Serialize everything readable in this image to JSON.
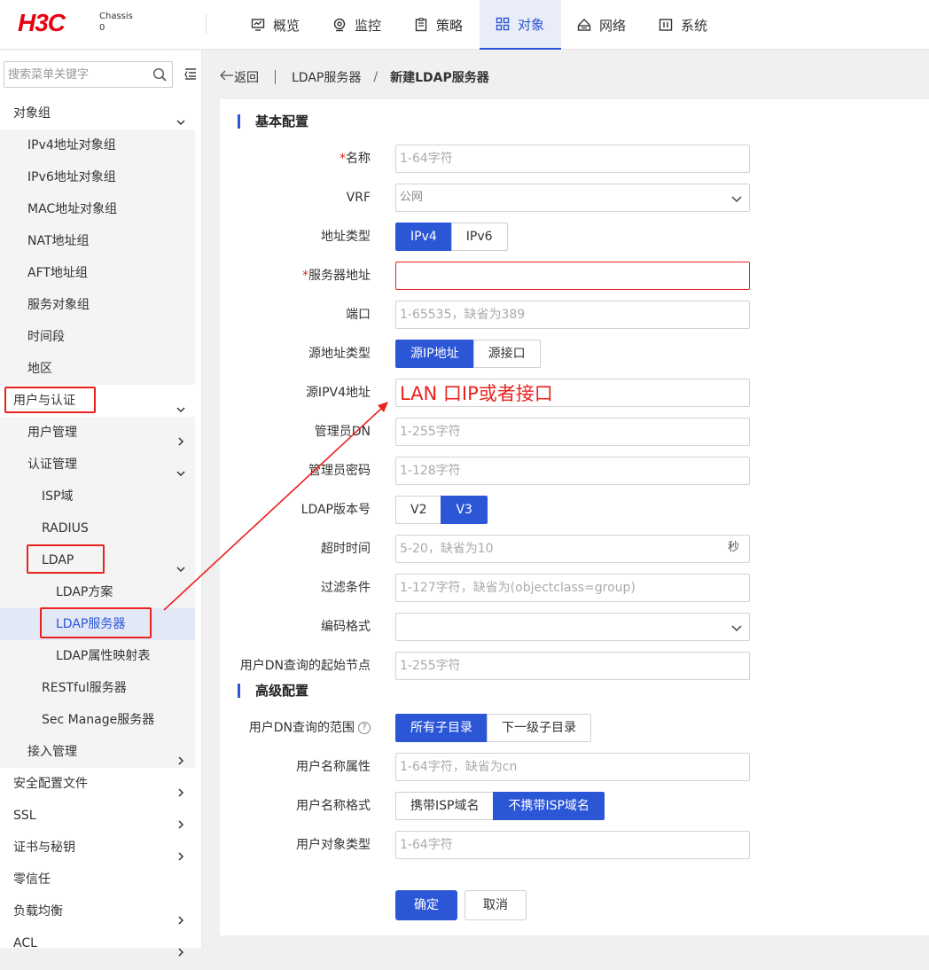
{
  "header": {
    "logo": "H3C",
    "chassis_label": "Chassis",
    "chassis_value": "0",
    "nav": [
      {
        "label": "概览",
        "icon": "monitor-chart-icon"
      },
      {
        "label": "监控",
        "icon": "eye-icon"
      },
      {
        "label": "策略",
        "icon": "document-icon"
      },
      {
        "label": "对象",
        "icon": "grid-icon"
      },
      {
        "label": "网络",
        "icon": "network-icon"
      },
      {
        "label": "系统",
        "icon": "settings-panel-icon"
      }
    ],
    "active_nav": "对象"
  },
  "sidebar": {
    "search_placeholder": "搜索菜单关键字",
    "items": [
      {
        "label": "对象组",
        "chevron": "down"
      },
      {
        "label": "IPv4地址对象组"
      },
      {
        "label": "IPv6地址对象组"
      },
      {
        "label": "MAC地址对象组"
      },
      {
        "label": "NAT地址组"
      },
      {
        "label": "AFT地址组"
      },
      {
        "label": "服务对象组"
      },
      {
        "label": "时间段"
      },
      {
        "label": "地区"
      },
      {
        "label": "用户与认证",
        "chevron": "down"
      },
      {
        "label": "用户管理",
        "chevron": "right"
      },
      {
        "label": "认证管理",
        "chevron": "down"
      },
      {
        "label": "ISP域"
      },
      {
        "label": "RADIUS"
      },
      {
        "label": "LDAP",
        "chevron": "down"
      },
      {
        "label": "LDAP方案"
      },
      {
        "label": "LDAP服务器"
      },
      {
        "label": "LDAP属性映射表"
      },
      {
        "label": "RESTful服务器"
      },
      {
        "label": "Sec Manage服务器"
      },
      {
        "label": "接入管理",
        "chevron": "right"
      },
      {
        "label": "安全配置文件",
        "chevron": "right"
      },
      {
        "label": "SSL",
        "chevron": "right"
      },
      {
        "label": "证书与秘钥",
        "chevron": "right"
      },
      {
        "label": "零信任"
      },
      {
        "label": "负载均衡",
        "chevron": "right"
      },
      {
        "label": "ACL",
        "chevron": "right"
      }
    ]
  },
  "breadcrumb": {
    "back": "返回",
    "parent": "LDAP服务器",
    "separator": "/",
    "current": "新建LDAP服务器"
  },
  "form": {
    "basic_title": "基本配置",
    "advanced_title": "高级配置",
    "name": {
      "label": "名称",
      "required": "*",
      "placeholder": "1-64字符"
    },
    "vrf": {
      "label": "VRF",
      "value": "公网"
    },
    "addr_type": {
      "label": "地址类型",
      "options": [
        "IPv4",
        "IPv6"
      ],
      "selected": "IPv4"
    },
    "server_addr": {
      "label": "服务器地址",
      "required": "*",
      "placeholder": ""
    },
    "port": {
      "label": "端口",
      "placeholder": "1-65535，缺省为389"
    },
    "src_addr_type": {
      "label": "源地址类型",
      "options": [
        "源IP地址",
        "源接口"
      ],
      "selected": "源IP地址"
    },
    "src_ipv4": {
      "label": "源IPV4地址",
      "value": ""
    },
    "admin_dn": {
      "label": "管理员DN",
      "placeholder": "1-255字符"
    },
    "admin_pwd": {
      "label": "管理员密码",
      "placeholder": "1-128字符"
    },
    "ldap_version": {
      "label": "LDAP版本号",
      "options": [
        "V2",
        "V3"
      ],
      "selected": "V3"
    },
    "timeout": {
      "label": "超时时间",
      "placeholder": "5-20，缺省为10",
      "unit": "秒"
    },
    "filter": {
      "label": "过滤条件",
      "placeholder": "1-127字符，缺省为(objectclass=group)"
    },
    "encoding": {
      "label": "编码格式",
      "value": ""
    },
    "start_node": {
      "label": "用户DN查询的起始节点",
      "placeholder": "1-255字符"
    },
    "dn_scope": {
      "label": "用户DN查询的范围",
      "options": [
        "所有子目录",
        "下一级子目录"
      ],
      "selected": "所有子目录",
      "help": "?"
    },
    "user_name_attr": {
      "label": "用户名称属性",
      "placeholder": "1-64字符，缺省为cn"
    },
    "user_name_format": {
      "label": "用户名称格式",
      "options": [
        "携带ISP域名",
        "不携带ISP域名"
      ],
      "selected": "不携带ISP域名"
    },
    "user_object_type": {
      "label": "用户对象类型",
      "placeholder": "1-64字符"
    },
    "ok": "确定",
    "cancel": "取消"
  },
  "annotation": {
    "text": "LAN 口IP或者接口",
    "color": "#e8231f"
  },
  "colors": {
    "primary": "#2b56d6",
    "brand": "#e60012",
    "annotation": "#e8231f"
  }
}
